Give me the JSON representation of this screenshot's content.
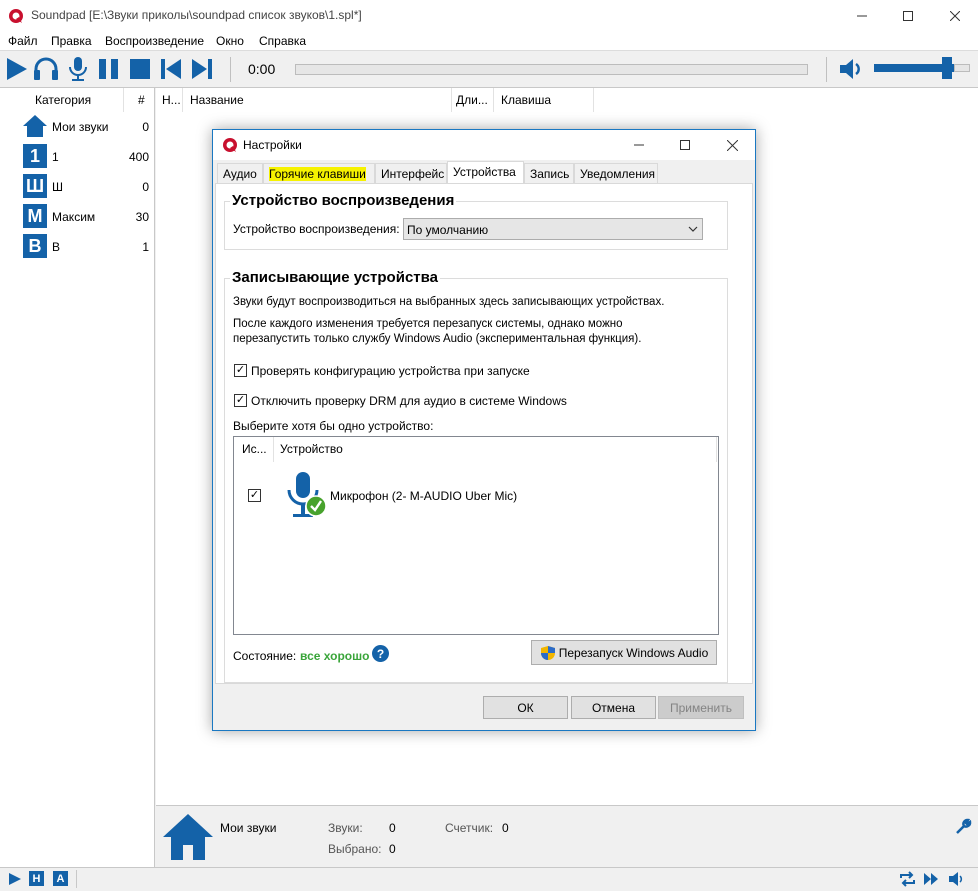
{
  "app": {
    "title": "Soundpad [E:\\Звуки приколы\\soundpad список звуков\\1.spl*]"
  },
  "menu": [
    "Файл",
    "Правка",
    "Воспроизведение",
    "Окно",
    "Справка"
  ],
  "player": {
    "time": "0:00",
    "volume_percent": 76
  },
  "left": {
    "col_category": "Категория",
    "col_count": "#",
    "items": [
      {
        "badge": "",
        "name": "Мои звуки",
        "count": "0"
      },
      {
        "badge": "1",
        "name": "1",
        "count": "400"
      },
      {
        "badge": "Ш",
        "name": "Ш",
        "count": "0"
      },
      {
        "badge": "М",
        "name": "Максим",
        "count": "30"
      },
      {
        "badge": "В",
        "name": "В",
        "count": "1"
      }
    ]
  },
  "list": {
    "col_num": "Н...",
    "col_name": "Название",
    "col_len": "Дли...",
    "col_key": "Клавиша"
  },
  "bottom": {
    "category": "Мои звуки",
    "sounds_label": "Звуки:",
    "sounds_value": "0",
    "counter_label": "Счетчик:",
    "counter_value": "0",
    "selected_label": "Выбрано:",
    "selected_value": "0"
  },
  "statusbar": {
    "badge_h": "H",
    "badge_a": "A"
  },
  "dialog": {
    "title": "Настройки",
    "tabs": [
      "Аудио",
      "Горячие клавиши",
      "Интерфейс",
      "Устройства",
      "Запись",
      "Уведомления"
    ],
    "active_tab": "Устройства",
    "highlighted_tab": "Горячие клавиши",
    "playback": {
      "group_title": "Устройство воспроизведения",
      "label": "Устройство воспроизведения:",
      "selected": "По умолчанию"
    },
    "recording": {
      "group_title": "Записывающие устройства",
      "desc1": "Звуки будут воспроизводиться на выбранных здесь записывающих устройствах.",
      "desc2a": "После каждого изменения требуется перезапуск системы, однако можно",
      "desc2b": "перезапустить только службу Windows Audio (экспериментальная функция).",
      "check1": "Проверять конфигурацию устройства при запуске",
      "check2": "Отключить проверку DRM для аудио в системе Windows",
      "choose": "Выберите хотя бы одно устройство:",
      "col_use": "Ис...",
      "col_device": "Устройство",
      "device_name": "Микрофон (2- M-AUDIO Uber Mic)",
      "status_label": "Состояние:",
      "status_value": "все хорошо",
      "restart_btn": "Перезапуск Windows Audio"
    },
    "buttons": {
      "ok": "ОК",
      "cancel": "Отмена",
      "apply": "Применить"
    }
  },
  "colors": {
    "accent": "#1462a8",
    "status_ok": "#3aa53a",
    "highlight": "#f6f200"
  }
}
